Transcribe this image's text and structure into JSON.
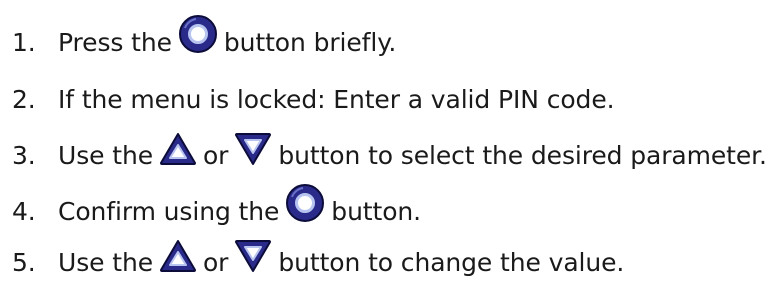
{
  "steps": [
    {
      "number": "1.",
      "before": "Press the",
      "icon1": "circle-button-icon",
      "after": "button briefly."
    },
    {
      "number": "2.",
      "text": "If the menu is locked: Enter a valid PIN code."
    },
    {
      "number": "3.",
      "before": "Use the",
      "icon1": "up-triangle-button-icon",
      "middle": "or",
      "icon2": "down-triangle-button-icon",
      "after": "button to select the desired parameter."
    },
    {
      "number": "4.",
      "before": "Confirm using the",
      "icon1": "circle-button-icon",
      "after": "button."
    },
    {
      "number": "5.",
      "before": "Use the",
      "icon1": "up-triangle-button-icon",
      "middle": "or",
      "icon2": "down-triangle-button-icon",
      "after": "button to change the value."
    }
  ],
  "colors": {
    "text": "#1a1a1a",
    "icon_fill": "#2a2a8a",
    "icon_outline": "#0c0c3a",
    "icon_highlight": "#b8c4f0"
  }
}
